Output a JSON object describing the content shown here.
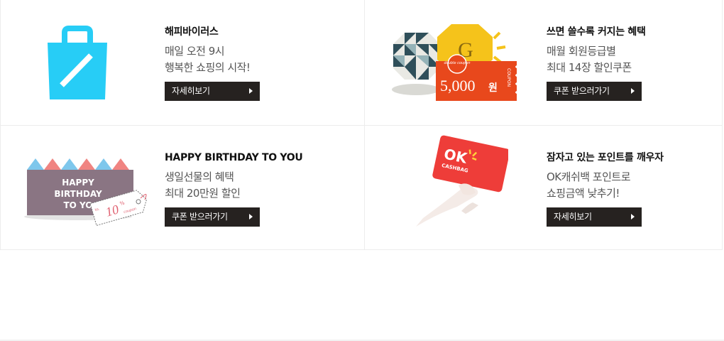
{
  "cards": [
    {
      "title": "해피바이러스",
      "desc": [
        "매일 오전 9시",
        "행복한 쇼핑의 시작!"
      ],
      "button": "자세히보기",
      "icon": "shopping-bag-icon"
    },
    {
      "title": "쓰면 쓸수록 커지는 혜택",
      "desc": [
        "매월 회원등급별",
        "최대 14장 할인쿠폰"
      ],
      "button": "쿠폰 받으러가기",
      "icon": "coupon-icon",
      "art": {
        "grade_letter": "G",
        "coupon_amount": "5,000",
        "coupon_unit": "원",
        "coupon_script": "double coupon",
        "coupon_side": "COUPON"
      }
    },
    {
      "title": "HAPPY BIRTHDAY TO YOU",
      "desc": [
        "생일선물의 혜택",
        "최대 20만원 할인"
      ],
      "button": "쿠폰 받으러가기",
      "icon": "birthday-tag-icon",
      "art": {
        "banner_line1": "HAPPY",
        "banner_line2": "BIRTHDAY",
        "banner_line3": "TO YO",
        "tag_value": "10",
        "tag_unit": "%",
        "tag_prefix": "to.",
        "tag_word": "coupon"
      }
    },
    {
      "title": "잠자고 있는 포인트를 깨우자",
      "desc": [
        "OK캐쉬백 포인트로",
        "쇼핑금액 낮추기!"
      ],
      "button": "자세히보기",
      "icon": "ok-cashbag-card-icon",
      "art": {
        "card_brand": "OK",
        "card_sub": "CASHBAG"
      }
    }
  ],
  "colors": {
    "bag": "#27cdf6",
    "button": "#262220",
    "coupon": "#e8481c",
    "gold": "#f5c31b",
    "banner": "#8a7583",
    "card": "#ee3d39"
  }
}
